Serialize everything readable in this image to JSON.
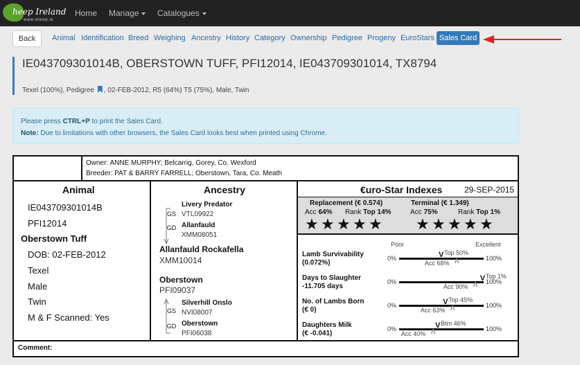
{
  "brand": {
    "logo_text": "heep Ireland",
    "logo_url": "www.sheep.ie",
    "accent": "#337ab7",
    "logo_color": "#5aa22c"
  },
  "navbar": {
    "home": "Home",
    "manage": "Manage",
    "catalogues": "Catalogues"
  },
  "tabs": {
    "back": "Back",
    "items": [
      "Animal",
      "Identification",
      "Breed",
      "Weighing",
      "Ancestry",
      "History",
      "Category",
      "Ownership",
      "Pedigree",
      "Progeny",
      "EuroStars"
    ],
    "active": "Sales Card"
  },
  "header": {
    "title": "IE043709301014B, OBERSTOWN TUFF, PFI12014, IE043709301014, TX8794",
    "sub_before": "Texel (100%), Pedigree",
    "sub_after": ", 02-FEB-2012, R5 (64%) T5 (75%), Male, Twin"
  },
  "info": {
    "line1_pre": "Please press ",
    "line1_key": "CTRL+P",
    "line1_post": " to print the Sales Card.",
    "line2_label": "Note:",
    "line2_text": " Due to limitations with other browsers, the Sales Card looks best when printed using Chrome."
  },
  "card": {
    "owner": "Owner: ANNE MURPHY; Belcarrig, Gorey, Co. Wexford",
    "breeder": "Breeder: PAT & BARRY FARRELL; Oberstown, Tara, Co. Meath",
    "animal": {
      "heading": "Animal",
      "id1": "IE043709301014B",
      "id2": "PFI12014",
      "name": "Oberstown Tuff",
      "dob": "DOB: 02-FEB-2012",
      "breed": "Texel",
      "sex": "Male",
      "birth": "Twin",
      "scanned": "M & F Scanned: Yes"
    },
    "ancestry": {
      "heading": "Ancestry",
      "gs1_name": "Livery Predator",
      "gs1_id": "VTL09922",
      "gs1_tag": "GS",
      "gd1_name": "Allanfauld",
      "gd1_id": "XMM08051",
      "gd1_tag": "GD",
      "sire_name": "Allanfauld Rockafella",
      "sire_id": "XMM10014",
      "dam_name": "Oberstown",
      "dam_id": "PFI09037",
      "gs2_name": "Silverhill Onslo",
      "gs2_id": "NVI08007",
      "gs2_tag": "GS",
      "gd2_name": "Oberstown",
      "gd2_id": "PFI06038",
      "gd2_tag": "GD"
    },
    "indexes": {
      "heading": "€uro-Star Indexes",
      "date": "29-SEP-2015",
      "replacement": {
        "label": "Replacement (€ 0.574)",
        "acc_label": "Acc",
        "acc": "64%",
        "rank_label": "Rank",
        "rank": "Top 14%",
        "stars": 5
      },
      "terminal": {
        "label": "Terminal (€ 1.349)",
        "acc_label": "Acc",
        "acc": "75%",
        "rank_label": "Rank",
        "rank": "Top 1%",
        "stars": 5
      },
      "poor": "Poor",
      "excellent": "Excellent",
      "zero": "0%",
      "hundred": "100%",
      "traits": [
        {
          "label1": "Lamb Survivability",
          "label2": "(0.072%)",
          "rank": "Top 50%",
          "acc": "Acc 68%",
          "rank_pos": 0.5,
          "acc_pos": 0.68
        },
        {
          "label1": "Days to Slaughter",
          "label2": "-11.705 days",
          "rank": "Top 1%",
          "acc": "Acc 90%",
          "rank_pos": 0.99,
          "acc_pos": 0.9
        },
        {
          "label1": "No. of Lambs Born",
          "label2": "(€ 0)",
          "rank": "Top 45%",
          "acc": "Acc 63%",
          "rank_pos": 0.55,
          "acc_pos": 0.63
        },
        {
          "label1": "Daughters Milk",
          "label2": "(€ -0.041)",
          "rank": "Btm 46%",
          "acc": "Acc 40%",
          "rank_pos": 0.46,
          "acc_pos": 0.4
        }
      ]
    },
    "comment": "Comment:"
  }
}
